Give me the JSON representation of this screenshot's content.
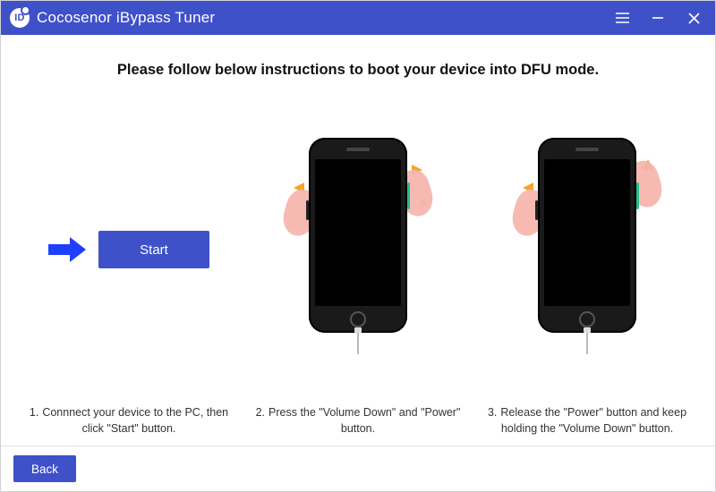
{
  "titlebar": {
    "app_name": "Cocosenor iBypass Tuner",
    "logo_text": "ID"
  },
  "main": {
    "headline": "Please follow below instructions to boot your device into DFU mode.",
    "start_label": "Start",
    "steps": [
      {
        "num": "1.",
        "text": "Connnect your device to the PC, then click \"Start\" button."
      },
      {
        "num": "2.",
        "text": "Press the \"Volume Down\" and \"Power\" button."
      },
      {
        "num": "3.",
        "text": "Release the \"Power\" button and keep holding the \"Volume Down\" button."
      }
    ]
  },
  "footer": {
    "back_label": "Back"
  }
}
